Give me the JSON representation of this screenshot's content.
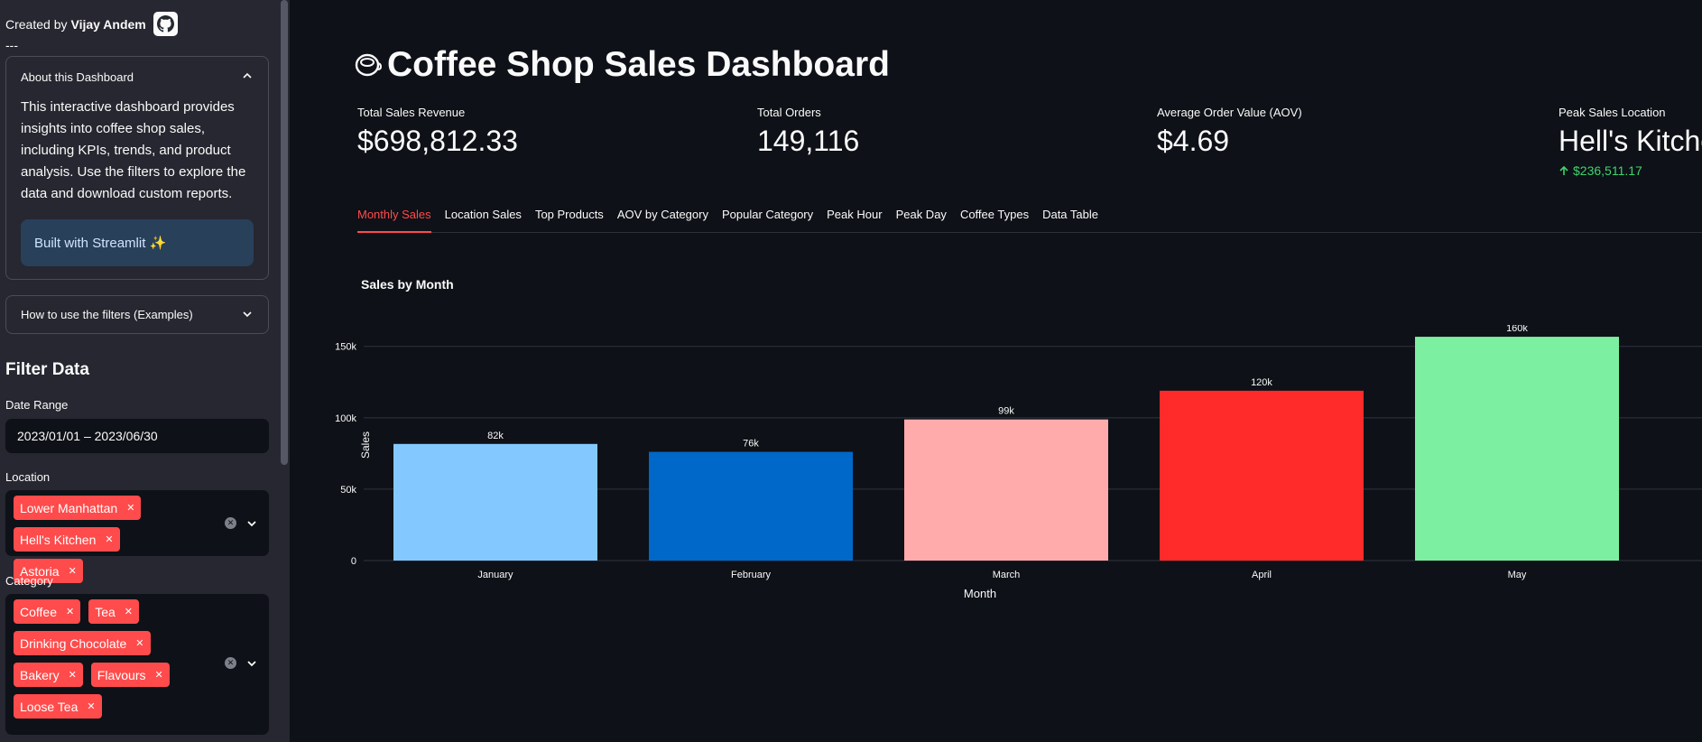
{
  "sidebar": {
    "created_prefix": "Created by",
    "author": "Vijay Andem",
    "github_icon": "github-icon",
    "separator": "---",
    "about": {
      "title": "About this Dashboard",
      "body": "This interactive dashboard provides insights into coffee shop sales, including KPIs, trends, and product analysis. Use the filters to explore the data and download custom reports.",
      "callout": "Built with Streamlit ✨"
    },
    "howto_title": "How to use the filters (Examples)",
    "filter_title": "Filter Data",
    "date_label": "Date Range",
    "date_value": "2023/01/01 – 2023/06/30",
    "location_label": "Location",
    "locations": [
      "Lower Manhattan",
      "Hell's Kitchen",
      "Astoria"
    ],
    "category_label": "Category",
    "categories": [
      "Coffee",
      "Tea",
      "Drinking Chocolate",
      "Bakery",
      "Flavours",
      "Loose Tea"
    ]
  },
  "main": {
    "title_icon": "coffee-cup-icon",
    "title": "Coffee Shop Sales Dashboard",
    "metrics": [
      {
        "label": "Total Sales Revenue",
        "value": "$698,812.33"
      },
      {
        "label": "Total Orders",
        "value": "149,116"
      },
      {
        "label": "Average Order Value (AOV)",
        "value": "$4.69"
      },
      {
        "label": "Peak Sales Location",
        "value": "Hell's Kitchen",
        "delta": "$236,511.17"
      }
    ],
    "tabs": [
      "Monthly Sales",
      "Location Sales",
      "Top Products",
      "AOV by Category",
      "Popular Category",
      "Peak Hour",
      "Peak Day",
      "Coffee Types",
      "Data Table"
    ],
    "active_tab": 0
  },
  "chart_data": {
    "type": "bar",
    "title": "Sales by Month",
    "xlabel": "Month",
    "ylabel": "Sales",
    "categories": [
      "January",
      "February",
      "March",
      "April",
      "May"
    ],
    "values": [
      81678,
      76145,
      98835,
      118941,
      156728
    ],
    "data_labels": [
      "82k",
      "76k",
      "99k",
      "120k",
      "160k"
    ],
    "colors": [
      "#83c9ff",
      "#0068c9",
      "#ffabab",
      "#ff2b2b",
      "#7defa1"
    ],
    "y_ticks": [
      0,
      50000,
      100000,
      150000
    ],
    "y_tick_labels": [
      "0",
      "50k",
      "100k",
      "150k"
    ],
    "ylim": [
      0,
      165000
    ],
    "grid": true
  }
}
